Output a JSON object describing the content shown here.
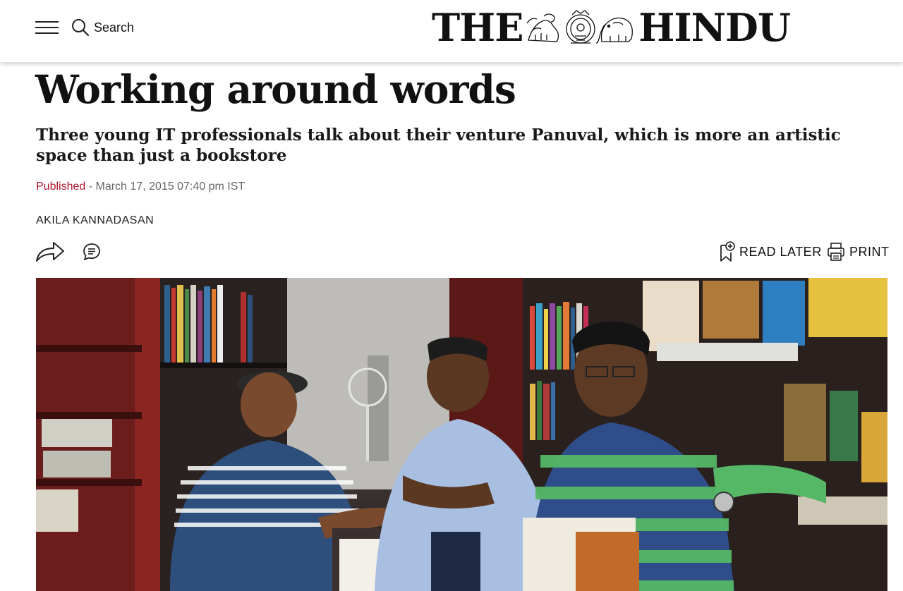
{
  "header": {
    "search_label": "Search",
    "logo_left": "THE",
    "logo_right": "HINDU"
  },
  "article": {
    "headline": "Working around words",
    "subheadline": "Three young IT professionals talk about their venture Panuval, which is more an artistic space than just a bookstore",
    "published_label": "Published",
    "published_separator": " - ",
    "published_date": "March 17, 2015 07:40 pm IST",
    "author": "AKILA KANNADASAN"
  },
  "actions": {
    "read_later_label": "READ LATER",
    "print_label": "PRINT"
  },
  "icons": {
    "menu": "hamburger-menu-icon",
    "search": "search-icon",
    "share": "share-arrow-icon",
    "comment": "comment-bubble-icon",
    "bookmark": "bookmark-plus-icon",
    "print": "printer-icon"
  },
  "colors": {
    "published_accent": "#b0132a",
    "text": "#111111",
    "meta_text": "#666666"
  }
}
